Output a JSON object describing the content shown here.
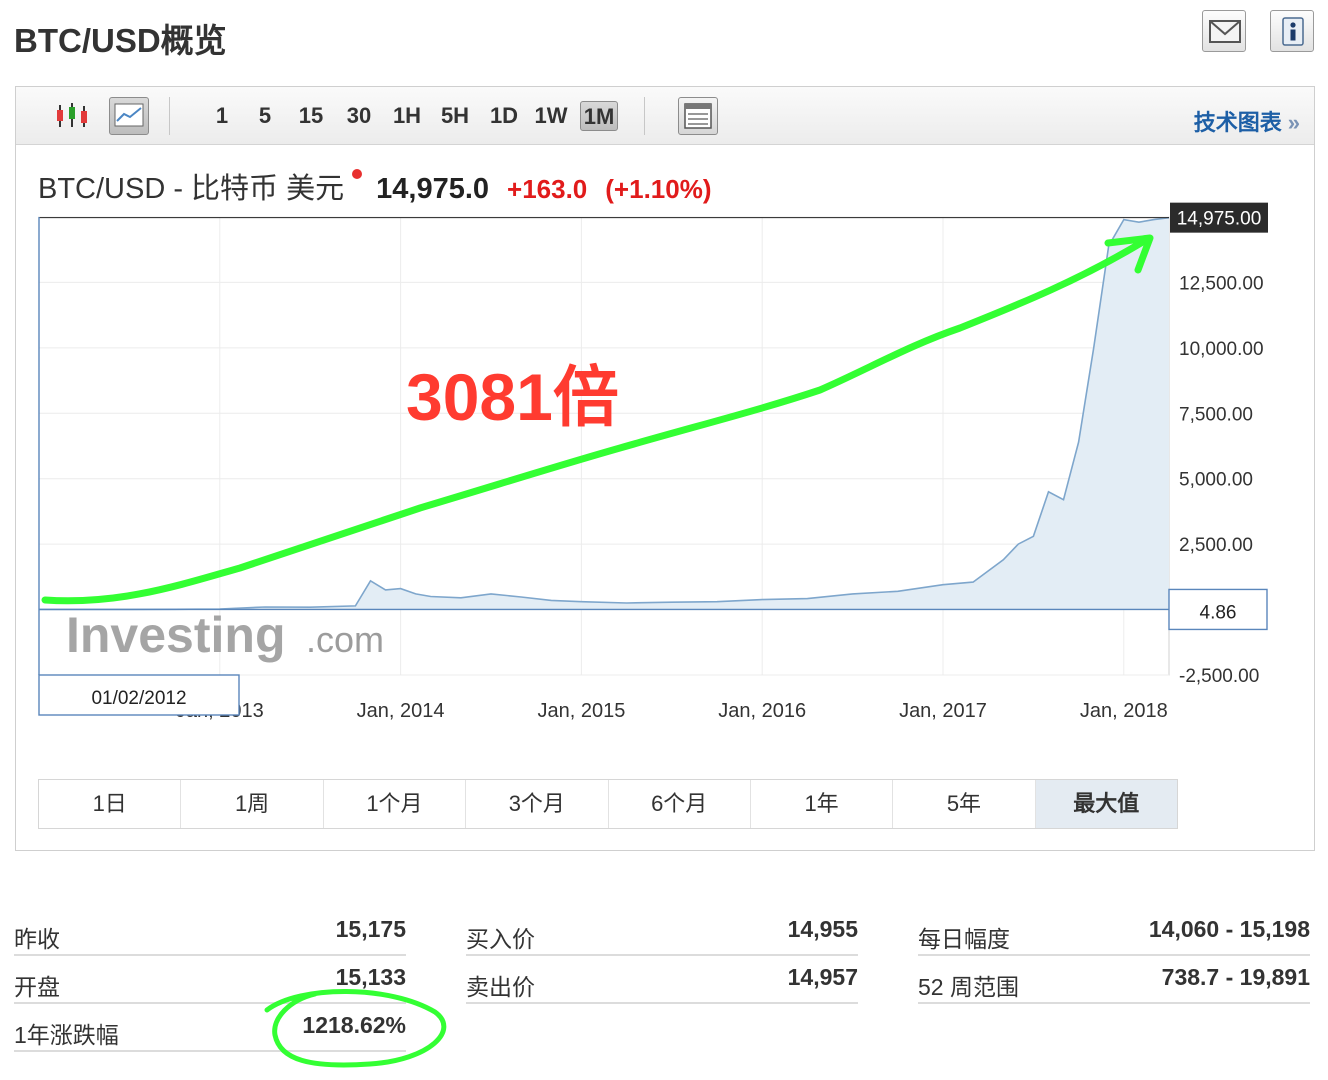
{
  "page": {
    "title": "BTC/USD概览"
  },
  "toolbar": {
    "intervals": [
      "1",
      "5",
      "15",
      "30",
      "1H",
      "5H",
      "1D",
      "1W",
      "1M"
    ],
    "active_interval": "1M",
    "tech_chart_label": "技术图表",
    "tech_chart_chevron": "»"
  },
  "quote": {
    "name": "BTC/USD - 比特币 美元",
    "price": "14,975.0",
    "change": "+163.0",
    "change_pct": "(+1.10%)"
  },
  "annotation": {
    "text": "3081倍",
    "color": "#ff3b30",
    "arrow_color": "#33ff33"
  },
  "chart_data": {
    "type": "area",
    "x": [
      "2012-01",
      "2012-04",
      "2012-07",
      "2012-10",
      "2013-01",
      "2013-04",
      "2013-07",
      "2013-10",
      "2013-11",
      "2013-12",
      "2014-01",
      "2014-02",
      "2014-03",
      "2014-05",
      "2014-07",
      "2014-09",
      "2014-11",
      "2015-01",
      "2015-04",
      "2015-07",
      "2015-10",
      "2016-01",
      "2016-04",
      "2016-07",
      "2016-10",
      "2017-01",
      "2017-03",
      "2017-05",
      "2017-06",
      "2017-07",
      "2017-08",
      "2017-09",
      "2017-10",
      "2017-11",
      "2017-12",
      "2018-01",
      "2018-02",
      "2018-03",
      "2018-04"
    ],
    "series": [
      {
        "values": [
          5,
          5,
          8,
          12,
          20,
          100,
          90,
          140,
          1100,
          750,
          800,
          600,
          500,
          450,
          600,
          480,
          350,
          300,
          250,
          280,
          300,
          380,
          420,
          600,
          700,
          950,
          1050,
          1900,
          2500,
          2800,
          4500,
          4200,
          6400,
          10000,
          13900,
          14900,
          14800,
          14900,
          14975
        ]
      }
    ],
    "xtick_labels": [
      "Jan, 2013",
      "Jan, 2014",
      "Jan, 2015",
      "Jan, 2016",
      "Jan, 2017",
      "Jan, 2018"
    ],
    "ytick_labels": [
      "12,500.00",
      "10,000.00",
      "7,500.00",
      "5,000.00",
      "2,500.00",
      "-2,500.00"
    ],
    "ylim": [
      -2500,
      15000
    ],
    "last_price_label": "14,975.00",
    "cursor_y_label": "4.86",
    "cursor_x_label": "01/02/2012",
    "fill_color": "#e3edf5",
    "line_color": "#7ea6cc"
  },
  "range_buttons": [
    "1日",
    "1周",
    "1个月",
    "3个月",
    "6个月",
    "1年",
    "5年",
    "最大值"
  ],
  "active_range": "最大值",
  "stats": {
    "col1": [
      {
        "label": "昨收",
        "value": "15,175"
      },
      {
        "label": "开盘",
        "value": "15,133"
      },
      {
        "label": "1年涨跌幅",
        "value": "1218.62%"
      }
    ],
    "col2": [
      {
        "label": "买入价",
        "value": "14,955"
      },
      {
        "label": "卖出价",
        "value": "14,957"
      }
    ],
    "col3": [
      {
        "label": "每日幅度",
        "value": "14,060 - 15,198"
      },
      {
        "label": "52 周范围",
        "value": "738.7 - 19,891"
      }
    ]
  },
  "watermark": {
    "brand": "Investing",
    "suffix": ".com"
  }
}
